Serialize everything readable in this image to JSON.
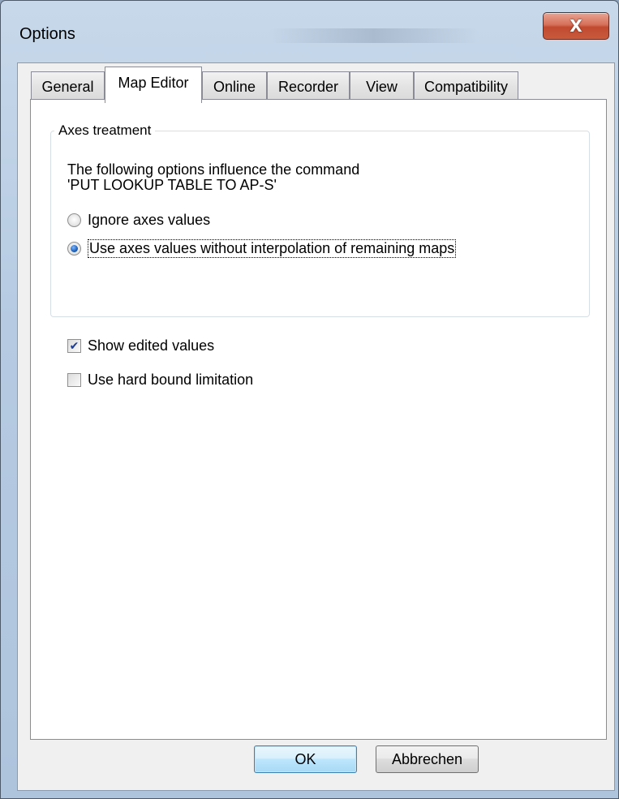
{
  "window": {
    "title": "Options",
    "close_label": "X"
  },
  "tabs": [
    {
      "label": "General",
      "active": false
    },
    {
      "label": "Map Editor",
      "active": true
    },
    {
      "label": "Online",
      "active": false
    },
    {
      "label": "Recorder",
      "active": false
    },
    {
      "label": "View",
      "active": false
    },
    {
      "label": "Compatibility",
      "active": false
    }
  ],
  "axes_group": {
    "legend": "Axes treatment",
    "description_line1": "The following options influence the command",
    "description_line2": "'PUT LOOKUP TABLE TO AP-S'",
    "options": [
      {
        "label": "Ignore axes values",
        "checked": false
      },
      {
        "label": "Use axes values without interpolation of remaining maps",
        "checked": true
      }
    ]
  },
  "checkboxes": [
    {
      "label": "Show edited values",
      "checked": true
    },
    {
      "label": "Use hard bound limitation",
      "checked": false
    }
  ],
  "buttons": {
    "ok": "OK",
    "cancel": "Abbrechen"
  },
  "colors": {
    "accent": "#3c7fb1",
    "close_button": "#c95a3c"
  }
}
